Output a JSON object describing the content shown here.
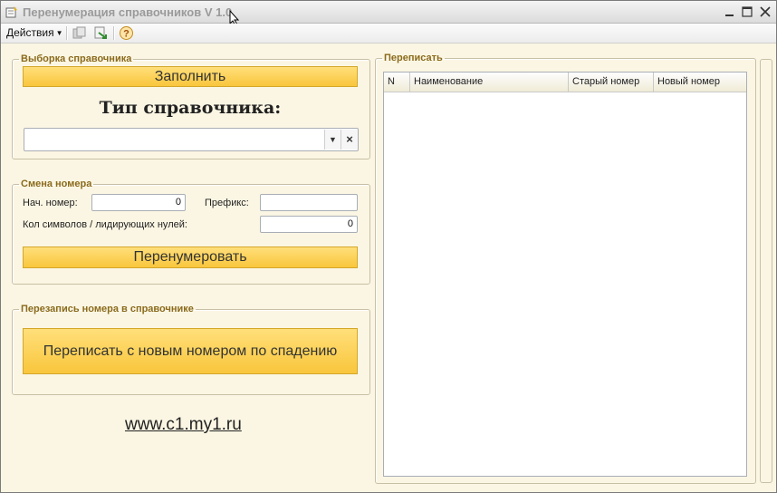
{
  "window": {
    "title": "Перенумерация справочников V 1.0",
    "controls": [
      "minimize-icon",
      "maximize-icon",
      "close-icon"
    ]
  },
  "toolbar": {
    "actions_label": "Действия",
    "icons": [
      "copy-icon",
      "move-icon",
      "help-icon"
    ]
  },
  "selection_group": {
    "legend": "Выборка справочника",
    "fill_button": "Заполнить",
    "type_label": "Тип справочника:",
    "type_value": ""
  },
  "number_group": {
    "legend": "Смена номера",
    "start_label": "Нач. номер:",
    "start_value": "0",
    "prefix_label": "Префикс:",
    "prefix_value": "",
    "digits_label": "Кол символов / лидирующих нулей:",
    "digits_value": "0",
    "renumber_button": "Перенумеровать"
  },
  "rewrite_group": {
    "legend": "Перезапись номера в справочнике",
    "rewrite_button": "Переписать с новым номером по спадению"
  },
  "footer_link": "www.c1.my1.ru",
  "table_group": {
    "legend": "Переписать",
    "columns": [
      "N",
      "Наименование",
      "Старый номер",
      "Новый номер"
    ],
    "rows": []
  },
  "colors": {
    "accent_button": "#f9c63c",
    "legend_text": "#8a6a1a",
    "form_background": "#fbf6e3"
  }
}
